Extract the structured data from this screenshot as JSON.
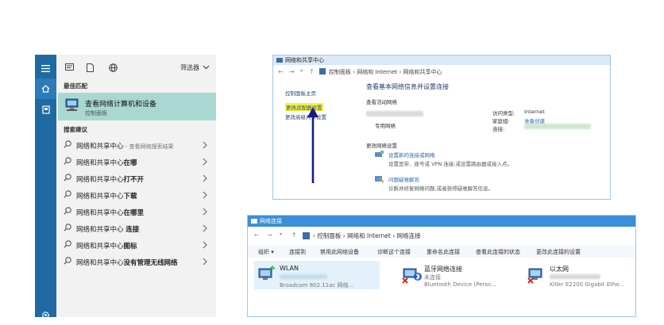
{
  "start_menu": {
    "filter_label": "筛选器",
    "best_match_header": "最佳匹配",
    "best_match": {
      "title": "查看网络计算机和设备",
      "subtitle": "控制面板"
    },
    "suggestions_header": "搜索建议",
    "suggestions": [
      {
        "prefix": "网络和共享中心",
        "bold": "",
        "hint": " - 查看网络搜索结果"
      },
      {
        "prefix": "网络和共享中心",
        "bold": "在哪",
        "hint": ""
      },
      {
        "prefix": "网络和共享中心",
        "bold": "打不开",
        "hint": ""
      },
      {
        "prefix": "网络和共享中心",
        "bold": "下载",
        "hint": ""
      },
      {
        "prefix": "网络和共享中心",
        "bold": "在哪里",
        "hint": ""
      },
      {
        "prefix": "网络和共享中心 ",
        "bold": "连接",
        "hint": ""
      },
      {
        "prefix": "网络和共享中心",
        "bold": "图标",
        "hint": ""
      },
      {
        "prefix": "网络和共享中心",
        "bold": "没有管理无线网络",
        "hint": ""
      }
    ]
  },
  "sharing_center": {
    "window_title": "网络和共享中心",
    "breadcrumb": [
      "控制面板",
      "网络和 Internet",
      "网络和共享中心"
    ],
    "sidebar": [
      "控制面板主页",
      "更改适配器设置",
      "更改高级共享设置"
    ],
    "heading": "查看基本网络信息并设置连接",
    "active_networks": "查看活动网络",
    "network_type": "专用网络",
    "access_type_label": "访问类型:",
    "access_type_value": "Internet",
    "homegroup_label": "家庭组:",
    "homegroup_value": "准备创建",
    "connections_label": "连接:",
    "change_settings": "更改网络设置",
    "new_connection_link": "设置新的连接或网络",
    "new_connection_desc": "设置宽带、拨号或 VPN 连接;或设置路由器或接入点。",
    "troubleshoot_link": "问题疑难解答",
    "troubleshoot_desc": "诊断并修复网络问题,或者获得疑难解答信息。"
  },
  "net_connections": {
    "window_title": "网络连接",
    "breadcrumb": [
      "控制面板",
      "网络和 Internet",
      "网络连接"
    ],
    "toolbar": [
      "组织 ▾",
      "连接到",
      "禁用此网络设备",
      "诊断这个连接",
      "重命名此连接",
      "查看此连接的状态",
      "更改此连接的设置"
    ],
    "adapters": [
      {
        "name": "WLAN",
        "status": "",
        "device": "Broadcom 802.11ac 网络..."
      },
      {
        "name": "蓝牙网络连接",
        "status": "未连接",
        "device": "Bluetooth Device (Perso..."
      },
      {
        "name": "以太网",
        "status": "网络电缆被拔出",
        "device": "Killer E2200 Gigabit Ethe..."
      }
    ]
  },
  "colors": {
    "rail": "#1f6aa3",
    "best_match_bg": "#a9d8d2",
    "arrow": "#1a1a8c",
    "highlight": "#f6f23a"
  }
}
